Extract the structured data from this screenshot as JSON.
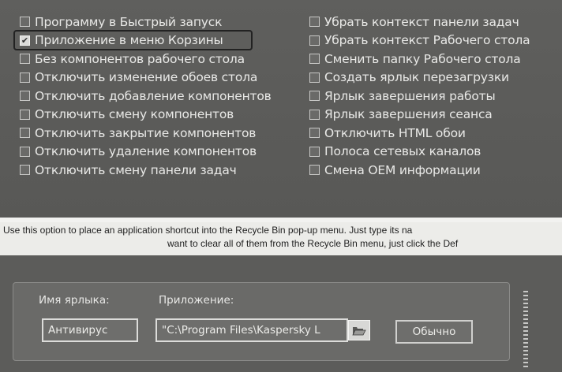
{
  "options": {
    "left": [
      {
        "label": "Программу в Быстрый запуск",
        "checked": false
      },
      {
        "label": "Приложение в меню Корзины",
        "checked": true,
        "highlighted": true
      },
      {
        "label": "Без компонентов рабочего стола",
        "checked": false
      },
      {
        "label": "Отключить изменение обоев стола",
        "checked": false
      },
      {
        "label": "Отключить добавление компонентов",
        "checked": false
      },
      {
        "label": "Отключить смену компонентов",
        "checked": false
      },
      {
        "label": "Отключить закрытие компонентов",
        "checked": false
      },
      {
        "label": "Отключить удаление компонентов",
        "checked": false
      },
      {
        "label": "Отключить смену панели задач",
        "checked": false
      }
    ],
    "right": [
      {
        "label": "Убрать контекст панели задач",
        "checked": false
      },
      {
        "label": "Убрать контекст Рабочего стола",
        "checked": false
      },
      {
        "label": "Сменить папку Рабочего стола",
        "checked": false
      },
      {
        "label": "Создать ярлык перезагрузки",
        "checked": false
      },
      {
        "label": "Ярлык завершения работы",
        "checked": false
      },
      {
        "label": "Ярлык завершения сеанса",
        "checked": false
      },
      {
        "label": "Отключить HTML обои",
        "checked": false
      },
      {
        "label": "Полоса сетевых каналов",
        "checked": false
      },
      {
        "label": "Смена OEM информации",
        "checked": false
      }
    ]
  },
  "description": {
    "line1": "Use this option to place an application shortcut into the Recycle Bin pop-up menu. Just type its na",
    "line2": "want to clear all of them from the Recycle Bin menu, just click the Def"
  },
  "form": {
    "shortcut_label": "Имя ярлыка:",
    "shortcut_value": "Антивирус",
    "app_label": "Приложение:",
    "app_value": "\"C:\\Program Files\\Kaspersky L",
    "default_button": "Обычно"
  },
  "icons": {
    "browse": "folder-open-icon",
    "check": "checkmark-icon"
  },
  "colors": {
    "panel": "#5c5c5a",
    "text": "#e9e9e7",
    "description_bg": "#ecece9"
  }
}
